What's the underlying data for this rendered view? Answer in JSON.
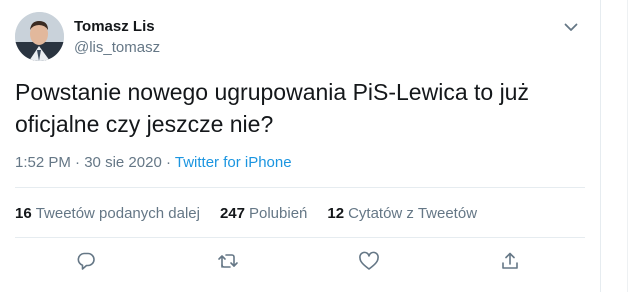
{
  "author": {
    "display_name": "Tomasz Lis",
    "handle": "@lis_tomasz",
    "avatar_icon": "profile-photo"
  },
  "tweet": {
    "text_line1": "Powstanie nowego ugrupowania PiS-Lewica to już",
    "text_line2": "oficjalne czy jeszcze nie?",
    "time": "1:52 PM",
    "separator": " · ",
    "date": "30 sie 2020",
    "source": "Twitter for iPhone"
  },
  "stats": {
    "retweets_count": "16",
    "retweets_label": "Tweetów podanych dalej",
    "likes_count": "247",
    "likes_label": "Polubień",
    "quotes_count": "12",
    "quotes_label": "Cytatów z Tweetów"
  },
  "actions": [
    "reply-icon",
    "retweet-icon",
    "like-icon",
    "share-icon"
  ],
  "colors": {
    "text": "#14171a",
    "secondary": "#657786",
    "link": "#1b95e0",
    "border": "#e6ecf0"
  }
}
